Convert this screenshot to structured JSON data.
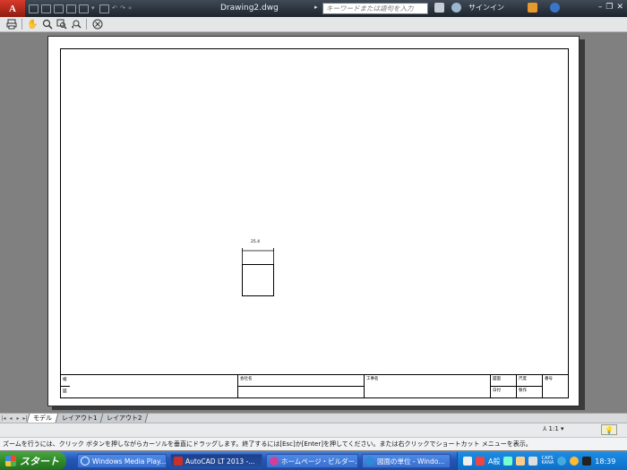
{
  "titlebar": {
    "app_letter": "A",
    "title": "Drawing2.dwg",
    "search_placeholder": "キーワードまたは語句を入力",
    "signin": "サインイン",
    "more": "»"
  },
  "toolbar": {
    "tools": [
      "print-icon",
      "pan-icon",
      "zoom-realtime-icon",
      "zoom-window-icon",
      "zoom-previous-icon",
      "close-circle-icon"
    ]
  },
  "drawing": {
    "title_block": {
      "company_label": "会社名",
      "project_label": "工事名",
      "drawing_no_label": "図面",
      "scale_label": "尺度",
      "sheet_label": "番号",
      "date_label": "日付",
      "drawn_label": "製作",
      "left_top": "検",
      "left_bottom": "図"
    },
    "dimension_text": "25.4"
  },
  "layout_tabs": {
    "tabs": [
      "モデル",
      "レイアウト1",
      "レイアウト2"
    ],
    "active": 0
  },
  "status": {
    "scale": "1:1",
    "command_text": "ズームを行うには、クリック ボタンを押しながらカーソルを垂直にドラッグします。終了するには[Esc]か[Enter]を押してください。または右クリックでショートカット メニューを表示。"
  },
  "taskbar": {
    "start_label": "スタート",
    "tasks": [
      {
        "label": "Windows Media Play...",
        "icon_color": "#3b7ad8"
      },
      {
        "label": "AutoCAD LT 2013 -...",
        "icon_color": "#c8302a"
      },
      {
        "label": "ホームページ・ビルダー...",
        "icon_color": "#d0409a"
      },
      {
        "label": "図面の単位 - Windo...",
        "icon_color": "#2e8ad8"
      }
    ],
    "active_task": 1,
    "tray": {
      "ime": "A般",
      "caps": "CAPS",
      "kana": "KANA",
      "clock": "18:39"
    }
  },
  "colors": {
    "accent": "#2457b8",
    "start": "#2f8a2a",
    "canvas_bg": "#808080"
  }
}
